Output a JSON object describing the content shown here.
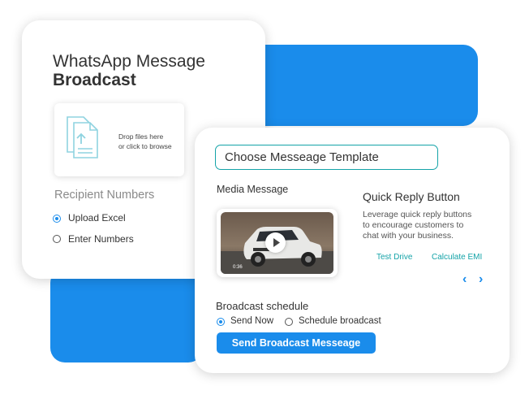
{
  "left_card": {
    "title_line1": "WhatsApp Message",
    "title_line2": "Broadcast",
    "dropzone": {
      "text_line1": "Drop files here",
      "text_line2": "or click to browse",
      "icon": "file-upload-icon"
    },
    "recipient_heading": "Recipient Numbers",
    "options": [
      {
        "label": "Upload Excel",
        "selected": true
      },
      {
        "label": "Enter Numbers",
        "selected": false
      }
    ]
  },
  "right_card": {
    "template_select": "Choose Messeage Template",
    "media_heading": "Media Message",
    "video": {
      "timestamp": "0:36",
      "play_icon": "play-icon"
    },
    "quick_reply": {
      "heading": "Quick Reply Button",
      "description_line1": "Leverage quick reply buttons",
      "description_line2": "to encourage customers to",
      "description_line3": "chat with your business.",
      "buttons": [
        "Test Drive",
        "Calculate EMI"
      ]
    },
    "schedule": {
      "heading": "Broadcast schedule",
      "options": [
        {
          "label": "Send Now",
          "selected": true
        },
        {
          "label": "Schedule broadcast",
          "selected": false
        }
      ]
    },
    "send_button": "Send Broadcast Messeage"
  },
  "colors": {
    "accent": "#1a8ceb",
    "teal": "#14a3a8",
    "text": "#333333"
  }
}
